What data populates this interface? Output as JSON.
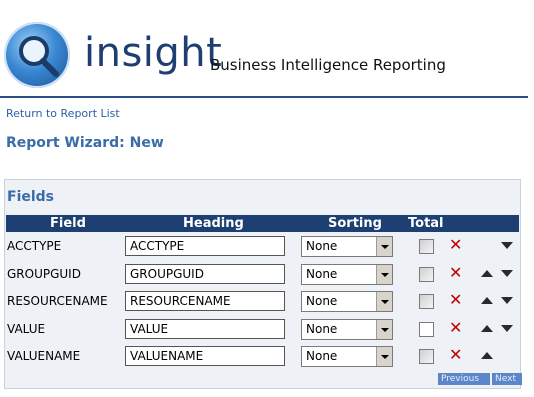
{
  "header": {
    "logo_text": "insight",
    "tagline": "Business Intelligence Reporting"
  },
  "nav": {
    "return_link": "Return to Report List"
  },
  "page": {
    "title": "Report Wizard: New"
  },
  "fields": {
    "section_title": "Fields",
    "columns": [
      "Field",
      "Heading",
      "Sorting",
      "Total"
    ],
    "rows": [
      {
        "field": "ACCTYPE",
        "heading": "ACCTYPE",
        "sorting": "None",
        "total": false,
        "can_move_up": false,
        "can_move_down": true
      },
      {
        "field": "GROUPGUID",
        "heading": "GROUPGUID",
        "sorting": "None",
        "total": false,
        "can_move_up": true,
        "can_move_down": true
      },
      {
        "field": "RESOURCENAME",
        "heading": "RESOURCENAME",
        "sorting": "None",
        "total": false,
        "can_move_up": true,
        "can_move_down": true
      },
      {
        "field": "VALUE",
        "heading": "VALUE",
        "sorting": "None",
        "total": false,
        "can_move_up": true,
        "can_move_down": true
      },
      {
        "field": "VALUENAME",
        "heading": "VALUENAME",
        "sorting": "None",
        "total": false,
        "can_move_up": true,
        "can_move_down": false
      }
    ]
  },
  "pager": {
    "previous_label": "Previous",
    "next_label": "Next"
  },
  "colors": {
    "header_bar": "#1d3f72",
    "title_blue": "#3a6da8",
    "delete_red": "#c00000",
    "pager_blue": "#5b86c9"
  }
}
